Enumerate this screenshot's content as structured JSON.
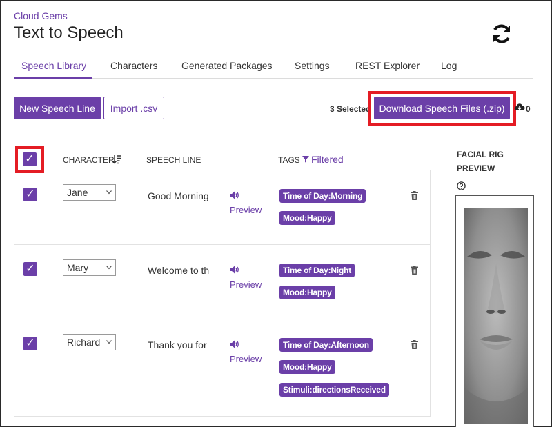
{
  "header": {
    "app_label": "Cloud Gems",
    "title": "Text to Speech",
    "refresh_icon": "refresh-icon"
  },
  "tabs": [
    {
      "label": "Speech Library",
      "active": true
    },
    {
      "label": "Characters",
      "active": false
    },
    {
      "label": "Generated Packages",
      "active": false
    },
    {
      "label": "Settings",
      "active": false
    },
    {
      "label": "REST Explorer",
      "active": false
    },
    {
      "label": "Log",
      "active": false
    }
  ],
  "toolbar": {
    "new_label": "New Speech Line",
    "import_label": "Import .csv",
    "selected_text": "3 Selected",
    "download_label": "Download Speech Files (.zip)",
    "cloud_icon": "cloud-download-icon",
    "cloud_count": "0"
  },
  "table": {
    "columns": {
      "character": "CHARACTER",
      "speech_line": "SPEECH LINE",
      "tags": "TAGS",
      "filtered": "Filtered"
    },
    "select_all_checked": true,
    "rows": [
      {
        "checked": true,
        "character": "Jane",
        "speech": "Good Morning",
        "preview": "Preview",
        "tags": [
          "Time of Day:Morning",
          "Mood:Happy"
        ]
      },
      {
        "checked": true,
        "character": "Mary",
        "speech": "Welcome to th",
        "preview": "Preview",
        "tags": [
          "Time of Day:Night",
          "Mood:Happy"
        ]
      },
      {
        "checked": true,
        "character": "Richard",
        "speech": "Thank you for",
        "preview": "Preview",
        "tags": [
          "Time of Day:Afternoon",
          "Mood:Happy",
          "Stimuli:directionsReceived"
        ]
      }
    ]
  },
  "facial_rig": {
    "title_line1": "FACIAL RIG",
    "title_line2": "PREVIEW",
    "help_icon": "help-circle-icon"
  },
  "colors": {
    "accent": "#6b3fa8",
    "highlight": "#e41c24"
  }
}
